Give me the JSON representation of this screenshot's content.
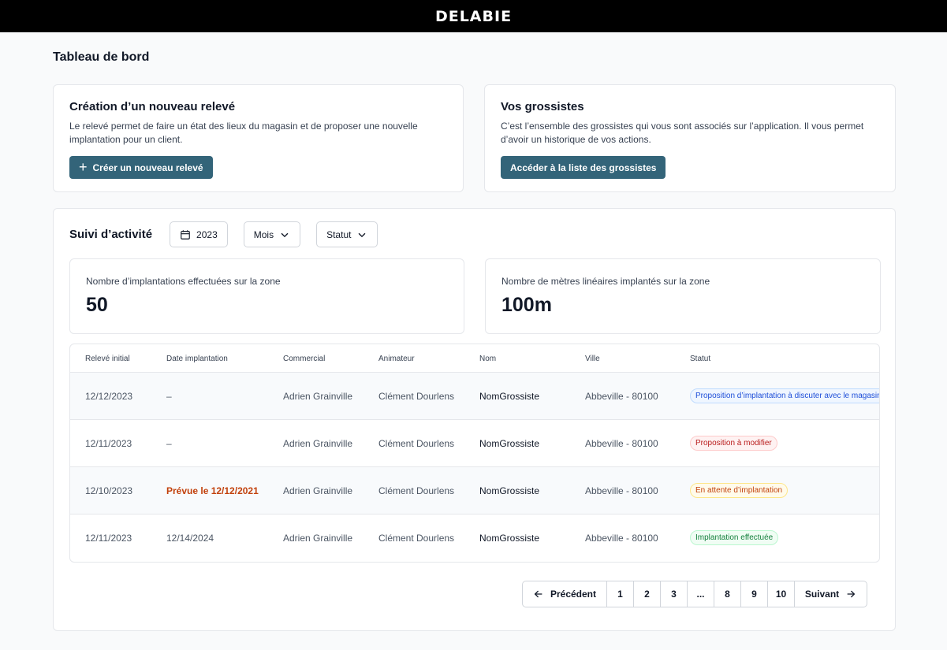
{
  "brand": {
    "logo": "DELABIE"
  },
  "page": {
    "title": "Tableau de bord"
  },
  "new_survey": {
    "title": "Création d’un nouveau relevé",
    "description": "Le relevé permet de faire un état des lieux du magasin et de proposer une nouvelle implantation pour un client.",
    "button_label": "Créer un nouveau relevé"
  },
  "wholesalers": {
    "title": "Vos grossistes",
    "description": "C’est l’ensemble des grossistes qui vous sont associés sur l’application. Il vous permet d’avoir un historique de vos actions.",
    "button_label": "Accéder à la liste des grossistes"
  },
  "activity": {
    "title": "Suivi d’activité",
    "filters": {
      "year": "2023",
      "month": "Mois",
      "status": "Statut"
    },
    "stats": [
      {
        "label": "Nombre d’implantations effectuées sur la zone",
        "value": "50"
      },
      {
        "label": "Nombre de mètres linéaires implantés sur la zone",
        "value": "100m"
      }
    ],
    "table": {
      "columns": [
        "Relevé initial",
        "Date implantation",
        "Commercial",
        "Animateur",
        "Nom",
        "Ville",
        "Statut"
      ],
      "rows": [
        {
          "initial": "12/12/2023",
          "date": "–",
          "commercial": "Adrien Grainville",
          "animator": "Clément Dourlens",
          "name": "NomGrossiste",
          "city": "Abbeville - 80100",
          "status": "Proposition d’implantation à discuter avec le magasin",
          "status_color": "#1d4ed8"
        },
        {
          "initial": "12/11/2023",
          "date": "–",
          "commercial": "Adrien Grainville",
          "animator": "Clément Dourlens",
          "name": "NomGrossiste",
          "city": "Abbeville - 80100",
          "status": "Proposition à modifier",
          "status_color": "#b91c1c"
        },
        {
          "initial": "12/10/2023",
          "date": "Prévue le 12/12/2021",
          "commercial": "Adrien Grainville",
          "animator": "Clément Dourlens",
          "name": "NomGrossiste",
          "city": "Abbeville - 80100",
          "status": "En attente d’implantation",
          "status_color": "#c2410c"
        },
        {
          "initial": "12/11/2023",
          "date": "12/14/2024",
          "commercial": "Adrien Grainville",
          "animator": "Clément Dourlens",
          "name": "NomGrossiste",
          "city": "Abbeville - 80100",
          "status": "Implantation effectuée",
          "status_color": "#15803d"
        }
      ]
    },
    "pagination": {
      "previous": "Précédent",
      "next": "Suivant",
      "pages": [
        "1",
        "2",
        "3",
        "...",
        "8",
        "9",
        "10"
      ]
    }
  },
  "colors": {
    "primary": "#336479",
    "topbar": "#000000"
  }
}
